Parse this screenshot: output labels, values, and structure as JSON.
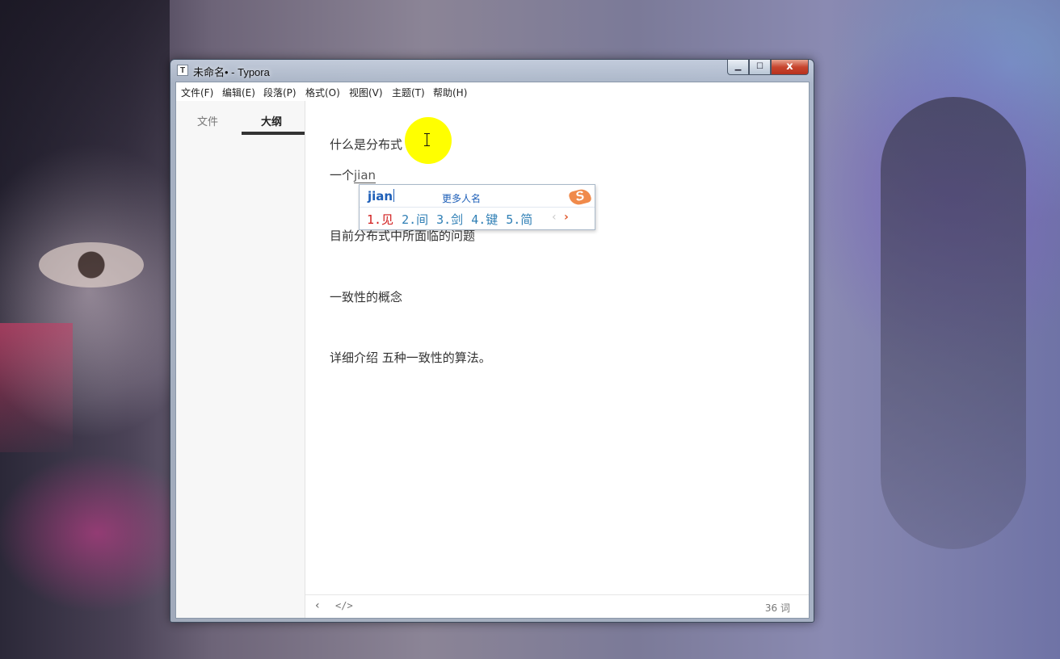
{
  "window": {
    "title": "未命名• - Typora",
    "app_icon": "T",
    "controls": {
      "minimize": "▁",
      "maximize": "☐",
      "close": "x"
    }
  },
  "menu": [
    {
      "label": "文件(F)"
    },
    {
      "label": "编辑(E)"
    },
    {
      "label": "段落(P)"
    },
    {
      "label": "格式(O)"
    },
    {
      "label": "视图(V)"
    },
    {
      "label": "主题(T)"
    },
    {
      "label": "帮助(H)"
    }
  ],
  "sidebar": {
    "tabs": [
      {
        "label": "文件",
        "active": false
      },
      {
        "label": "大纲",
        "active": true
      }
    ]
  },
  "document": {
    "line1": "什么是分布式",
    "line2_prefix": "一个",
    "line2_composing": "jian",
    "line3": "目前分布式中所面临的问题",
    "line4": "一致性的概念",
    "line5": "详细介绍 五种一致性的算法。"
  },
  "ime": {
    "composing": "jian",
    "more_label": "更多人名",
    "logo": "S",
    "candidates": [
      "1.见",
      "2.间",
      "3.剑",
      "4.键",
      "5.简"
    ],
    "prev": "‹",
    "next": "›"
  },
  "statusbar": {
    "back": "‹",
    "source_toggle": "</>",
    "word_count": "36 词"
  },
  "colors": {
    "ime_accent": "#1e5fb8",
    "candidate_selected": "#d11d1d",
    "logo": "#f08a4b",
    "cursor_highlight": "#ffff00"
  }
}
